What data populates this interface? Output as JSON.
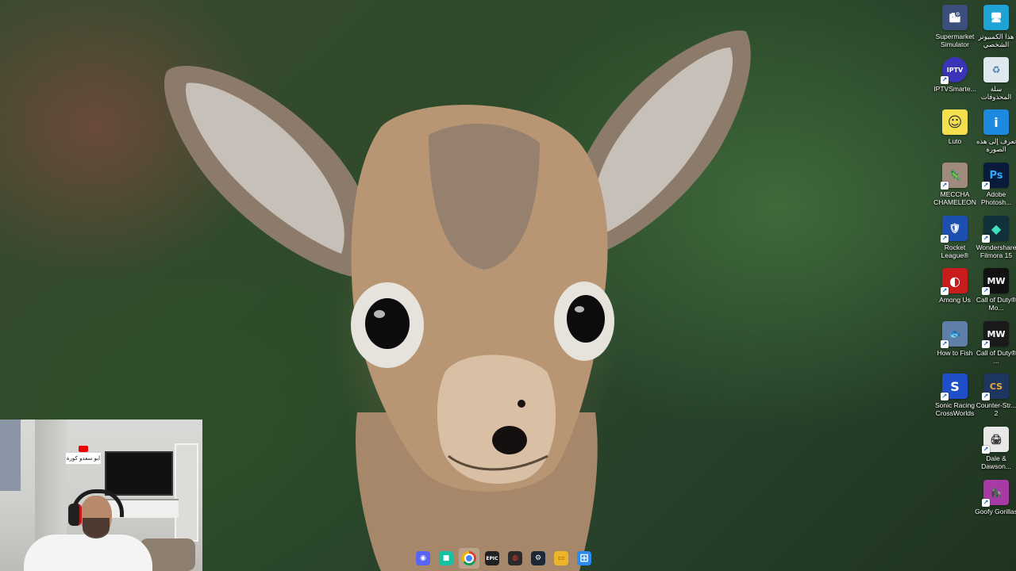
{
  "desktop": {
    "icons": [
      {
        "label": "Supermarket Simulator",
        "icon": "supermarket-simulator-icon",
        "color": "#3b4f7a",
        "glyph": "🏙"
      },
      {
        "label": "هذا الكمبيوتر الشخصي",
        "icon": "this-pc-icon",
        "color": "#1fa3d6",
        "glyph": "🖥"
      },
      {
        "label": "IPTVSmarte...",
        "icon": "iptv-smarters-icon",
        "color": "#3a35b8",
        "glyph": "IPTV"
      },
      {
        "label": "سلة المحذوفات",
        "icon": "recycle-bin-icon",
        "color": "#dfe8ef",
        "glyph": "♻"
      },
      {
        "label": "Luto",
        "icon": "luto-icon",
        "color": "#f4e04d",
        "glyph": "☺"
      },
      {
        "label": "تعرف إلى هذه الصورة",
        "icon": "learn-about-picture-icon",
        "color": "#1d8ae0",
        "glyph": "i"
      },
      {
        "label": "MECCHA CHAMELEON",
        "icon": "meccha-chameleon-icon",
        "color": "#a08a7d",
        "glyph": "🦎"
      },
      {
        "label": "Adobe Photosh...",
        "icon": "photoshop-icon",
        "color": "#0a1a3a",
        "glyph": "Ps"
      },
      {
        "label": "Rocket League®",
        "icon": "rocket-league-icon",
        "color": "#1d4fb0",
        "glyph": "🛡"
      },
      {
        "label": "Wondershare Filmora 15",
        "icon": "filmora-icon",
        "color": "#12303a",
        "glyph": "◆"
      },
      {
        "label": "Among Us",
        "icon": "among-us-icon",
        "color": "#c91c1c",
        "glyph": "◐"
      },
      {
        "label": "Call of Duty® Mo...",
        "icon": "call-of-duty-mw-icon",
        "color": "#111111",
        "glyph": "MW"
      },
      {
        "label": "How to Fish",
        "icon": "how-to-fish-icon",
        "color": "#5f7fa8",
        "glyph": "🐟"
      },
      {
        "label": "Call of Duty® ...",
        "icon": "call-of-duty-icon",
        "color": "#1a1a1a",
        "glyph": "MW"
      },
      {
        "label": "Sonic Racing CrossWorlds",
        "icon": "sonic-racing-icon",
        "color": "#1f4ec9",
        "glyph": "S"
      },
      {
        "label": "Counter-Str... 2",
        "icon": "counter-strike-icon",
        "color": "#1e3760",
        "glyph": "CS"
      },
      {
        "label": "Dale & Dawson...",
        "icon": "dale-dawson-icon",
        "color": "#e8e8e8",
        "glyph": "🖨"
      },
      {
        "label": "Goofy Gorillas",
        "icon": "goofy-gorillas-icon",
        "color": "#a83aa6",
        "glyph": "🦍"
      }
    ]
  },
  "webcam": {
    "sign_text": "ابو سعدو كورة"
  },
  "taskbar": {
    "apps": [
      {
        "name": "discord-icon",
        "color": "#5865f2",
        "glyph": "◉",
        "active": false
      },
      {
        "name": "app-teal-icon",
        "color": "#16c2a3",
        "glyph": "■",
        "active": false
      },
      {
        "name": "chrome-icon",
        "color": "#e8a71a",
        "glyph": "◎",
        "active": true
      },
      {
        "name": "epic-games-icon",
        "color": "#202020",
        "glyph": "EPIC",
        "active": false
      },
      {
        "name": "app-red-icon",
        "color": "#2a2a2a",
        "glyph": "◍",
        "active": false
      },
      {
        "name": "steam-icon",
        "color": "#1b2838",
        "glyph": "⚙",
        "active": false
      },
      {
        "name": "file-explorer-icon",
        "color": "#f0b429",
        "glyph": "▭",
        "active": false
      },
      {
        "name": "windows-start-icon",
        "color": "#2a8cf0",
        "glyph": "⊞",
        "active": false
      }
    ]
  }
}
